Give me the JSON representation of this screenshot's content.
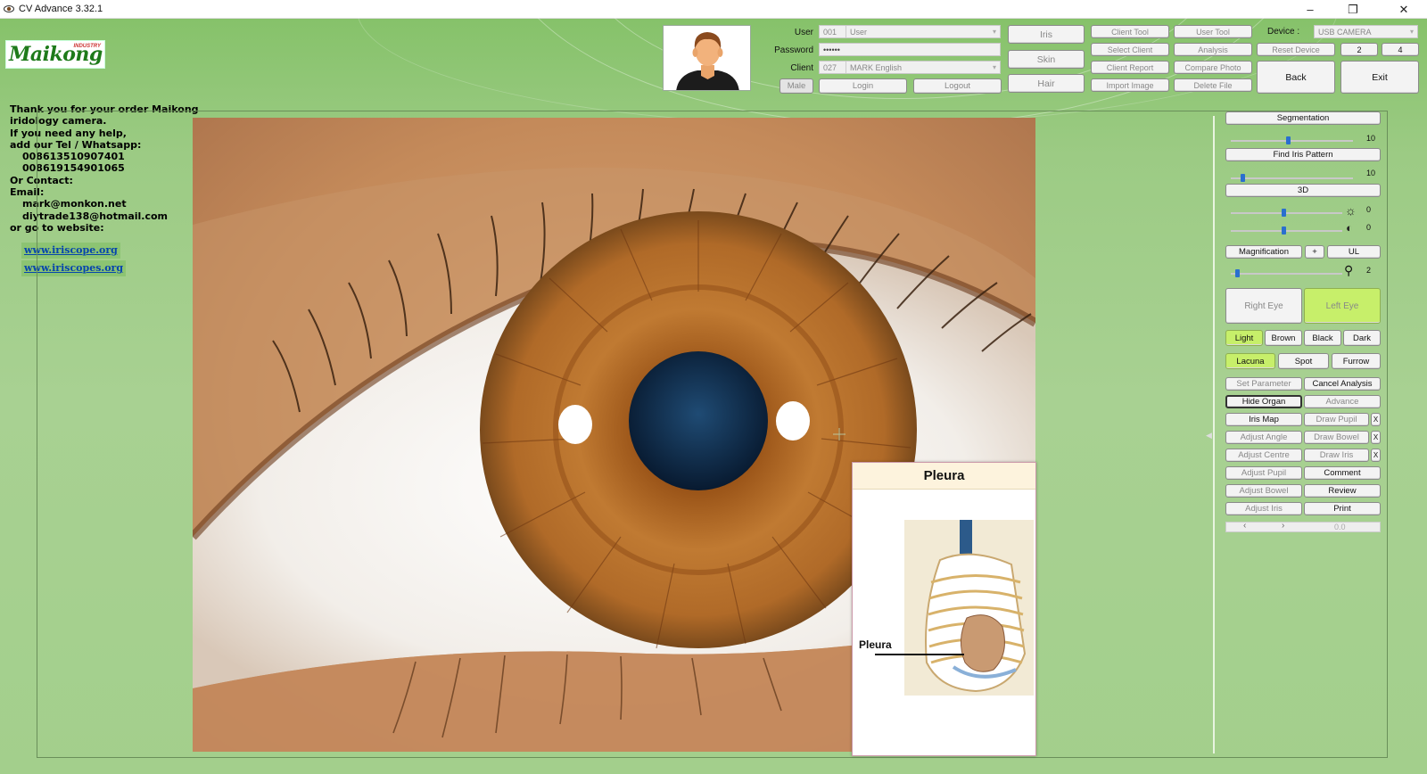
{
  "window": {
    "title": "CV Advance 3.32.1"
  },
  "brand": {
    "logo_text": "Maikong",
    "logo_sub": "INDUSTRY"
  },
  "contact": {
    "lines": [
      "Thank you for your order Maikong",
      "iridology camera.",
      "If you need any help,",
      "add our  Tel / Whatsapp:",
      "008613510907401",
      "008619154901065",
      "Or Contact:",
      "Email:",
      "mark@monkon.net",
      "diytrade138@hotmail.com",
      "or go to website:"
    ],
    "links": [
      "www.iriscope.org",
      "www.iriscopes.org"
    ]
  },
  "login": {
    "user_label": "User",
    "user_code": "001",
    "user_name": "User",
    "password_label": "Password",
    "password_value": "••••••",
    "client_label": "Client",
    "client_code": "027",
    "client_name": "MARK English",
    "gender": "Male",
    "login": "Login",
    "logout": "Logout"
  },
  "toolbar": {
    "iris": "Iris",
    "skin": "Skin",
    "hair": "Hair",
    "client_tool": "Client Tool",
    "select_client": "Select Client",
    "client_report": "Client Report",
    "import_image": "Import Image",
    "user_tool": "User Tool",
    "analysis": "Analysis",
    "compare_photo": "Compare Photo",
    "delete_file": "Delete File",
    "device_label": "Device :",
    "device_value": "USB CAMERA",
    "reset_device": "Reset Device",
    "two": "2",
    "four": "4",
    "back": "Back",
    "exit": "Exit"
  },
  "controls": {
    "segmentation": "Segmentation",
    "segmentation_value": "10",
    "find_iris_pattern": "Find Iris Pattern",
    "find_iris_value": "10",
    "three_d": "3D",
    "brightness_value": "0",
    "contrast_value": "0",
    "magnification": "Magnification",
    "plus": "+",
    "ul": "UL",
    "magnification_value": "2",
    "right_eye": "Right Eye",
    "left_eye": "Left Eye",
    "colors": [
      "Light",
      "Brown",
      "Black",
      "Dark"
    ],
    "marks": [
      "Lacuna",
      "Spot",
      "Furrow"
    ],
    "set_parameter": "Set Parameter",
    "cancel_analysis": "Cancel Analysis",
    "hide_organ": "Hide Organ",
    "advance": "Advance",
    "iris_map": "Iris Map",
    "draw_pupil": "Draw Pupil",
    "adjust_angle": "Adjust Angle",
    "draw_bowel": "Draw Bowel",
    "adjust_centre": "Adjust Centre",
    "draw_iris": "Draw Iris",
    "adjust_pupil": "Adjust Pupil",
    "comment": "Comment",
    "adjust_bowel": "Adjust Bowel",
    "review": "Review",
    "adjust_iris": "Adjust Iris",
    "print": "Print",
    "x": "X",
    "nav_left": "‹",
    "nav_right": "›",
    "angle_value": "0.0"
  },
  "popup": {
    "title": "Pleura",
    "label": "Pleura"
  },
  "colors": {
    "accent_green": "#c7ef6a",
    "background_green": "#a3cf8c",
    "iris_brown": "#b8702c",
    "pupil": "#0e2a48"
  }
}
